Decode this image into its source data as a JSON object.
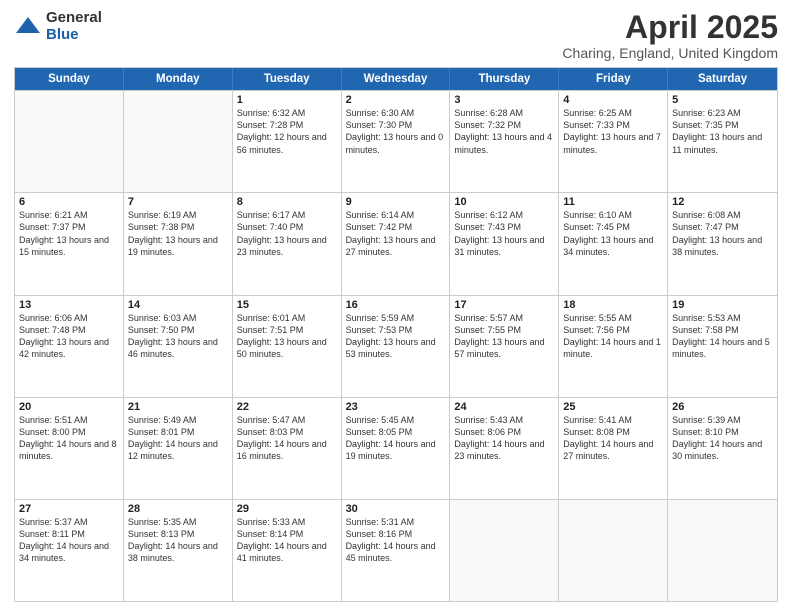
{
  "header": {
    "logo_general": "General",
    "logo_blue": "Blue",
    "month_title": "April 2025",
    "location": "Charing, England, United Kingdom"
  },
  "days_of_week": [
    "Sunday",
    "Monday",
    "Tuesday",
    "Wednesday",
    "Thursday",
    "Friday",
    "Saturday"
  ],
  "weeks": [
    [
      {
        "day": "",
        "detail": ""
      },
      {
        "day": "",
        "detail": ""
      },
      {
        "day": "1",
        "detail": "Sunrise: 6:32 AM\nSunset: 7:28 PM\nDaylight: 12 hours and 56 minutes."
      },
      {
        "day": "2",
        "detail": "Sunrise: 6:30 AM\nSunset: 7:30 PM\nDaylight: 13 hours and 0 minutes."
      },
      {
        "day": "3",
        "detail": "Sunrise: 6:28 AM\nSunset: 7:32 PM\nDaylight: 13 hours and 4 minutes."
      },
      {
        "day": "4",
        "detail": "Sunrise: 6:25 AM\nSunset: 7:33 PM\nDaylight: 13 hours and 7 minutes."
      },
      {
        "day": "5",
        "detail": "Sunrise: 6:23 AM\nSunset: 7:35 PM\nDaylight: 13 hours and 11 minutes."
      }
    ],
    [
      {
        "day": "6",
        "detail": "Sunrise: 6:21 AM\nSunset: 7:37 PM\nDaylight: 13 hours and 15 minutes."
      },
      {
        "day": "7",
        "detail": "Sunrise: 6:19 AM\nSunset: 7:38 PM\nDaylight: 13 hours and 19 minutes."
      },
      {
        "day": "8",
        "detail": "Sunrise: 6:17 AM\nSunset: 7:40 PM\nDaylight: 13 hours and 23 minutes."
      },
      {
        "day": "9",
        "detail": "Sunrise: 6:14 AM\nSunset: 7:42 PM\nDaylight: 13 hours and 27 minutes."
      },
      {
        "day": "10",
        "detail": "Sunrise: 6:12 AM\nSunset: 7:43 PM\nDaylight: 13 hours and 31 minutes."
      },
      {
        "day": "11",
        "detail": "Sunrise: 6:10 AM\nSunset: 7:45 PM\nDaylight: 13 hours and 34 minutes."
      },
      {
        "day": "12",
        "detail": "Sunrise: 6:08 AM\nSunset: 7:47 PM\nDaylight: 13 hours and 38 minutes."
      }
    ],
    [
      {
        "day": "13",
        "detail": "Sunrise: 6:06 AM\nSunset: 7:48 PM\nDaylight: 13 hours and 42 minutes."
      },
      {
        "day": "14",
        "detail": "Sunrise: 6:03 AM\nSunset: 7:50 PM\nDaylight: 13 hours and 46 minutes."
      },
      {
        "day": "15",
        "detail": "Sunrise: 6:01 AM\nSunset: 7:51 PM\nDaylight: 13 hours and 50 minutes."
      },
      {
        "day": "16",
        "detail": "Sunrise: 5:59 AM\nSunset: 7:53 PM\nDaylight: 13 hours and 53 minutes."
      },
      {
        "day": "17",
        "detail": "Sunrise: 5:57 AM\nSunset: 7:55 PM\nDaylight: 13 hours and 57 minutes."
      },
      {
        "day": "18",
        "detail": "Sunrise: 5:55 AM\nSunset: 7:56 PM\nDaylight: 14 hours and 1 minute."
      },
      {
        "day": "19",
        "detail": "Sunrise: 5:53 AM\nSunset: 7:58 PM\nDaylight: 14 hours and 5 minutes."
      }
    ],
    [
      {
        "day": "20",
        "detail": "Sunrise: 5:51 AM\nSunset: 8:00 PM\nDaylight: 14 hours and 8 minutes."
      },
      {
        "day": "21",
        "detail": "Sunrise: 5:49 AM\nSunset: 8:01 PM\nDaylight: 14 hours and 12 minutes."
      },
      {
        "day": "22",
        "detail": "Sunrise: 5:47 AM\nSunset: 8:03 PM\nDaylight: 14 hours and 16 minutes."
      },
      {
        "day": "23",
        "detail": "Sunrise: 5:45 AM\nSunset: 8:05 PM\nDaylight: 14 hours and 19 minutes."
      },
      {
        "day": "24",
        "detail": "Sunrise: 5:43 AM\nSunset: 8:06 PM\nDaylight: 14 hours and 23 minutes."
      },
      {
        "day": "25",
        "detail": "Sunrise: 5:41 AM\nSunset: 8:08 PM\nDaylight: 14 hours and 27 minutes."
      },
      {
        "day": "26",
        "detail": "Sunrise: 5:39 AM\nSunset: 8:10 PM\nDaylight: 14 hours and 30 minutes."
      }
    ],
    [
      {
        "day": "27",
        "detail": "Sunrise: 5:37 AM\nSunset: 8:11 PM\nDaylight: 14 hours and 34 minutes."
      },
      {
        "day": "28",
        "detail": "Sunrise: 5:35 AM\nSunset: 8:13 PM\nDaylight: 14 hours and 38 minutes."
      },
      {
        "day": "29",
        "detail": "Sunrise: 5:33 AM\nSunset: 8:14 PM\nDaylight: 14 hours and 41 minutes."
      },
      {
        "day": "30",
        "detail": "Sunrise: 5:31 AM\nSunset: 8:16 PM\nDaylight: 14 hours and 45 minutes."
      },
      {
        "day": "",
        "detail": ""
      },
      {
        "day": "",
        "detail": ""
      },
      {
        "day": "",
        "detail": ""
      }
    ]
  ]
}
